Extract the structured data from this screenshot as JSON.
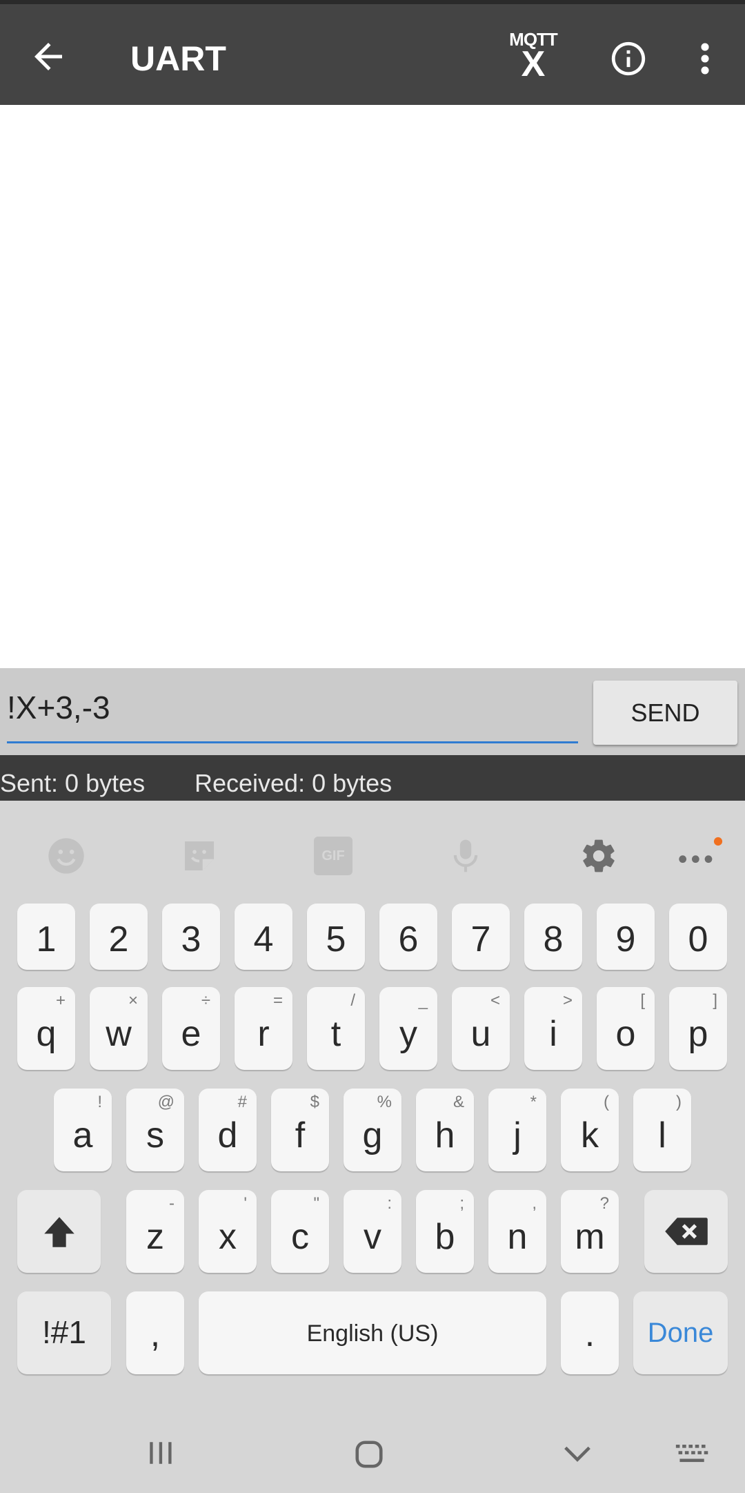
{
  "app_bar": {
    "title": "UART",
    "mqtt_label": "MQTT",
    "mqtt_x": "X",
    "colors": {
      "bar": "#444444",
      "text": "#ffffff"
    }
  },
  "input": {
    "value": "!X+3,-3",
    "send_label": "SEND",
    "accent": "#2f7bd1"
  },
  "status": {
    "sent": "Sent: 0 bytes",
    "received": "Received: 0 bytes"
  },
  "keyboard": {
    "toolbar": [
      "emoji-icon",
      "sticker-icon",
      "gif-icon",
      "mic-icon",
      "settings-icon",
      "more-icon"
    ],
    "gif_label": "GIF",
    "number_row": [
      "1",
      "2",
      "3",
      "4",
      "5",
      "6",
      "7",
      "8",
      "9",
      "0"
    ],
    "row1": [
      {
        "k": "q",
        "s": "+"
      },
      {
        "k": "w",
        "s": "×"
      },
      {
        "k": "e",
        "s": "÷"
      },
      {
        "k": "r",
        "s": "="
      },
      {
        "k": "t",
        "s": "/"
      },
      {
        "k": "y",
        "s": "_"
      },
      {
        "k": "u",
        "s": "<"
      },
      {
        "k": "i",
        "s": ">"
      },
      {
        "k": "o",
        "s": "["
      },
      {
        "k": "p",
        "s": "]"
      }
    ],
    "row2": [
      {
        "k": "a",
        "s": "!"
      },
      {
        "k": "s",
        "s": "@"
      },
      {
        "k": "d",
        "s": "#"
      },
      {
        "k": "f",
        "s": "$"
      },
      {
        "k": "g",
        "s": "%"
      },
      {
        "k": "h",
        "s": "&"
      },
      {
        "k": "j",
        "s": "*"
      },
      {
        "k": "k",
        "s": "("
      },
      {
        "k": "l",
        "s": ")"
      }
    ],
    "row3": [
      {
        "k": "z",
        "s": "-"
      },
      {
        "k": "x",
        "s": "'"
      },
      {
        "k": "c",
        "s": "\""
      },
      {
        "k": "v",
        "s": ":"
      },
      {
        "k": "b",
        "s": ";"
      },
      {
        "k": "n",
        "s": ","
      },
      {
        "k": "m",
        "s": "?"
      }
    ],
    "symbols_label": "!#1",
    "comma": ",",
    "space_label": "English (US)",
    "period": ".",
    "done_label": "Done",
    "done_color": "#3a88d8"
  },
  "nav": [
    "recent-apps-icon",
    "home-icon",
    "back-down-icon",
    "keyboard-icon"
  ]
}
